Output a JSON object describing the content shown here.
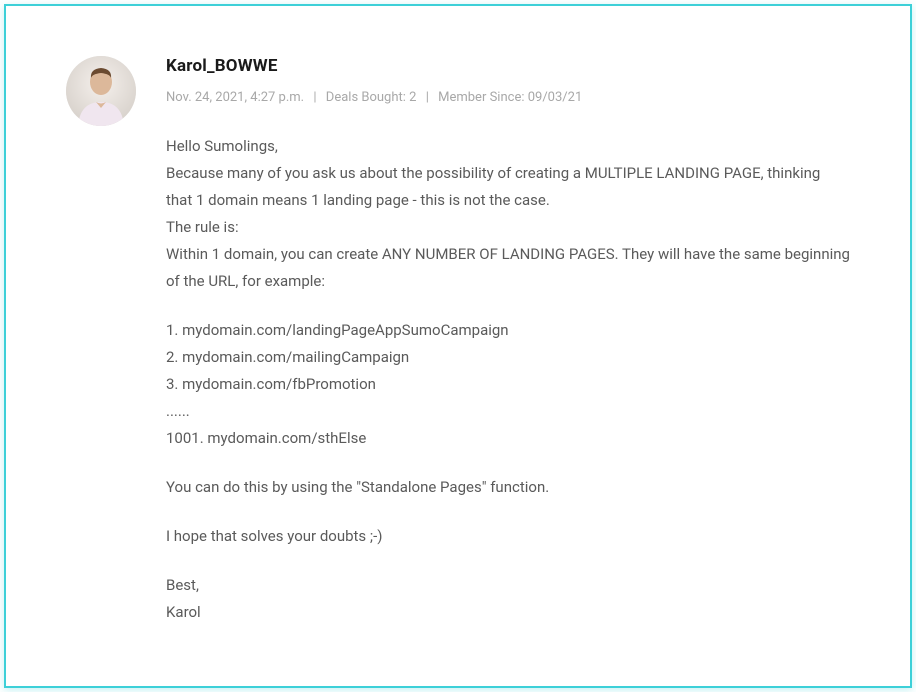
{
  "comment": {
    "author": "Karol_BOWWE",
    "meta": {
      "timestamp": "Nov. 24, 2021, 4:27 p.m.",
      "deals_bought_label": "Deals Bought: 2",
      "member_since_label": "Member Since: 09/03/21"
    },
    "body": {
      "line1": "Hello Sumolings,",
      "line2": "Because many of you ask us about the possibility of creating a MULTIPLE LANDING PAGE, thinking that 1 domain means 1 landing page - this is not the case.",
      "line3": "The rule is:",
      "line4": "Within 1 domain, you can create ANY NUMBER OF LANDING PAGES. They will have the same beginning of the URL, for example:",
      "ex1": "1. mydomain.com/landingPageAppSumoCampaign",
      "ex2": "2. mydomain.com/mailingCampaign",
      "ex3": "3. mydomain.com/fbPromotion",
      "dots": "......",
      "ex_last": "1001. mydomain.com/sthElse",
      "line5": "You can do this by using the \"Standalone Pages\" function.",
      "line6": "I hope that solves your doubts ;-)",
      "signoff1": "Best,",
      "signoff2": "Karol"
    }
  }
}
